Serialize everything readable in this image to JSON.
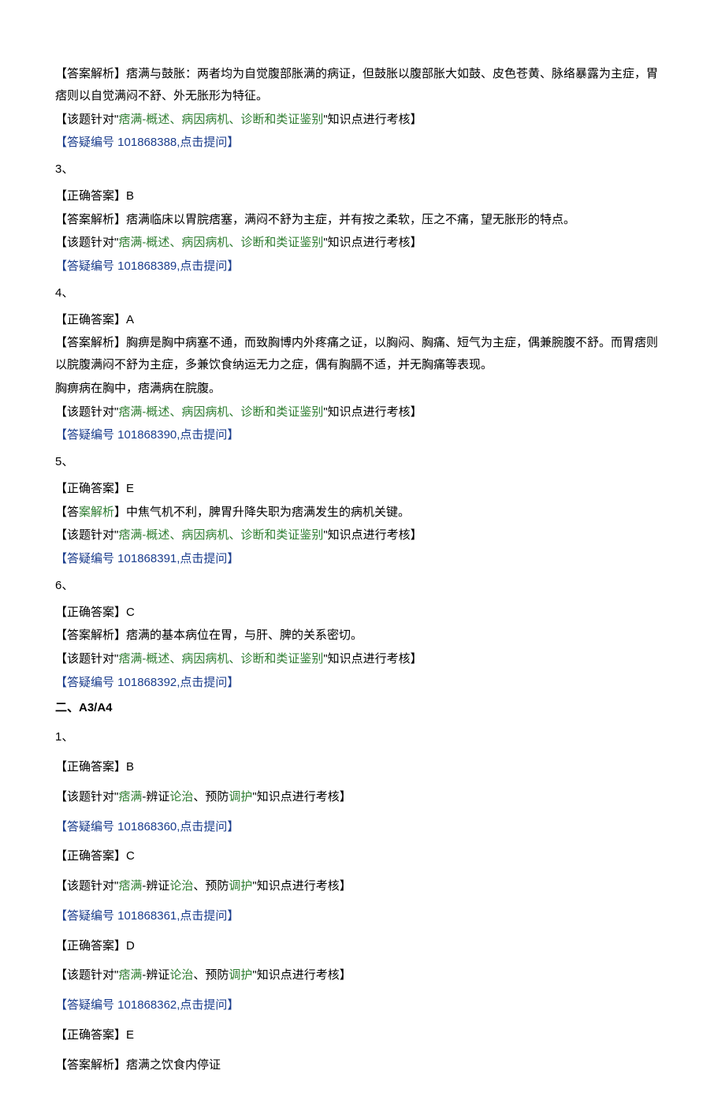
{
  "q2": {
    "analysis_label": "【答案解析】",
    "analysis_text": "痞满与鼓胀：两者均为自觉腹部胀满的病证，但鼓胀以腹部胀大如鼓、皮色苍黄、脉络暴露为主症，胃痞则以自觉满闷不舒、外无胀形为特征。",
    "note_prefix": "【该题针对\"",
    "note_green": "痞满-概述、病因病机、诊断和类证鉴别",
    "note_suffix": "\"知识点进行考核】",
    "link": "【答疑编号 101868388,点击提问】"
  },
  "q3": {
    "num": "3、",
    "correct_label": "【正确答案】",
    "correct_ans": "B",
    "analysis_label": "【答案解析】",
    "analysis_text": "痞满临床以胃脘痞塞，满闷不舒为主症，并有按之柔软，压之不痛，望无胀形的特点。",
    "note_prefix": "【该题针对\"",
    "note_green": "痞满-概述、病因病机、诊断和类证鉴别",
    "note_suffix": "\"知识点进行考核】",
    "link": "【答疑编号 101868389,点击提问】"
  },
  "q4": {
    "num": "4、",
    "correct_label": "【正确答案】",
    "correct_ans": "A",
    "analysis_label": "【答案解析】",
    "analysis_text1": "胸痹是胸中病塞不通，而致胸博内外疼痛之证，以胸闷、胸痛、短气为主症，偶兼腕腹不舒。而胃痞则以脘腹满闷不舒为主症，多兼饮食纳运无力之症，偶有胸膈不适，并无胸痛等表现。",
    "analysis_text2": "胸痹病在胸中，痞满病在脘腹。",
    "note_prefix": "【该题针对\"",
    "note_green": "痞满-概述、病因病机、诊断和类证鉴别",
    "note_suffix": "\"知识点进行考核】",
    "link": "【答疑编号 101868390,点击提问】"
  },
  "q5": {
    "num": "5、",
    "correct_label": "【正确答案】",
    "correct_ans": "E",
    "analysis_p1": "【答",
    "analysis_g1": "案解析",
    "analysis_p2": "】中焦气机不利，脾胃升降失职为痞满发生的病机关键。",
    "note_prefix": "【该题针对\"",
    "note_green": "痞满-概述、病因病机、诊断和类证鉴别",
    "note_suffix": "\"知识点进行考核】",
    "link": "【答疑编号 101868391,点击提问】"
  },
  "q6": {
    "num": "6、",
    "correct_label": "【正确答案】",
    "correct_ans": "C",
    "analysis_label": "【答案解析】",
    "analysis_text": "痞满的基本病位在胃，与肝、脾的关系密切。",
    "note_prefix": "【该题针对\"",
    "note_green": "痞满-概述、病因病机、诊断和类证鉴别",
    "note_suffix": "\"知识点进行考核】",
    "link": "【答疑编号 101868392,点击提问】"
  },
  "sec2": {
    "heading": "二、A3/A4"
  },
  "s2q1": {
    "num": "1、",
    "a": {
      "correct_label": "【正确答案】",
      "correct_ans": "B",
      "note_prefix": "【该题针对\"",
      "note_g1": "痞满",
      "note_b1": "-辨证",
      "note_g2": "论治",
      "note_b2": "、预防",
      "note_g3": "调护",
      "note_suffix": "\"知识点进行考核】",
      "link": "【答疑编号 101868360,点击提问】"
    },
    "b": {
      "correct_label": "【正确答案】",
      "correct_ans": "C",
      "note_prefix": "【该题针对\"",
      "note_g1": "痞满",
      "note_b1": "-辨证",
      "note_g2": "论治",
      "note_b2": "、预防",
      "note_g3": "调护",
      "note_suffix": "\"知识点进行考核】",
      "link": "【答疑编号 101868361,点击提问】"
    },
    "c": {
      "correct_label": "【正确答案】",
      "correct_ans": "D",
      "note_prefix": "【该题针对\"",
      "note_g1": "痞满",
      "note_b1": "-辨证",
      "note_g2": "论治",
      "note_b2": "、预防",
      "note_g3": "调护",
      "note_suffix": "\"知识点进行考核】",
      "link": "【答疑编号 101868362,点击提问】"
    },
    "d": {
      "correct_label": "【正确答案】",
      "correct_ans": "E",
      "analysis_label": "【答案解析】",
      "analysis_text": "痞满之饮食内停证"
    }
  }
}
